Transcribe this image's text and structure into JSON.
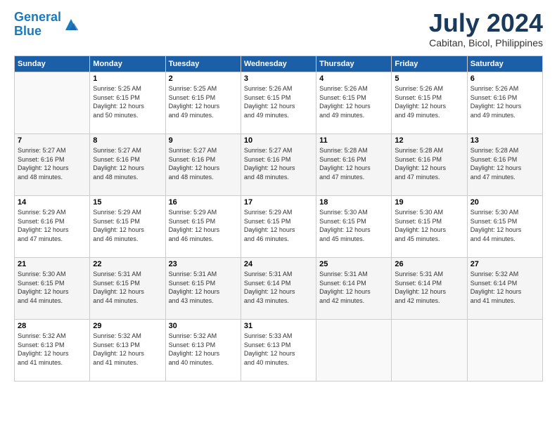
{
  "header": {
    "logo_line1": "General",
    "logo_line2": "Blue",
    "month_year": "July 2024",
    "location": "Cabitan, Bicol, Philippines"
  },
  "days_of_week": [
    "Sunday",
    "Monday",
    "Tuesday",
    "Wednesday",
    "Thursday",
    "Friday",
    "Saturday"
  ],
  "weeks": [
    [
      {
        "day": "",
        "content": ""
      },
      {
        "day": "1",
        "content": "Sunrise: 5:25 AM\nSunset: 6:15 PM\nDaylight: 12 hours\nand 50 minutes."
      },
      {
        "day": "2",
        "content": "Sunrise: 5:25 AM\nSunset: 6:15 PM\nDaylight: 12 hours\nand 49 minutes."
      },
      {
        "day": "3",
        "content": "Sunrise: 5:26 AM\nSunset: 6:15 PM\nDaylight: 12 hours\nand 49 minutes."
      },
      {
        "day": "4",
        "content": "Sunrise: 5:26 AM\nSunset: 6:15 PM\nDaylight: 12 hours\nand 49 minutes."
      },
      {
        "day": "5",
        "content": "Sunrise: 5:26 AM\nSunset: 6:15 PM\nDaylight: 12 hours\nand 49 minutes."
      },
      {
        "day": "6",
        "content": "Sunrise: 5:26 AM\nSunset: 6:16 PM\nDaylight: 12 hours\nand 49 minutes."
      }
    ],
    [
      {
        "day": "7",
        "content": "Sunrise: 5:27 AM\nSunset: 6:16 PM\nDaylight: 12 hours\nand 48 minutes."
      },
      {
        "day": "8",
        "content": "Sunrise: 5:27 AM\nSunset: 6:16 PM\nDaylight: 12 hours\nand 48 minutes."
      },
      {
        "day": "9",
        "content": "Sunrise: 5:27 AM\nSunset: 6:16 PM\nDaylight: 12 hours\nand 48 minutes."
      },
      {
        "day": "10",
        "content": "Sunrise: 5:27 AM\nSunset: 6:16 PM\nDaylight: 12 hours\nand 48 minutes."
      },
      {
        "day": "11",
        "content": "Sunrise: 5:28 AM\nSunset: 6:16 PM\nDaylight: 12 hours\nand 47 minutes."
      },
      {
        "day": "12",
        "content": "Sunrise: 5:28 AM\nSunset: 6:16 PM\nDaylight: 12 hours\nand 47 minutes."
      },
      {
        "day": "13",
        "content": "Sunrise: 5:28 AM\nSunset: 6:16 PM\nDaylight: 12 hours\nand 47 minutes."
      }
    ],
    [
      {
        "day": "14",
        "content": "Sunrise: 5:29 AM\nSunset: 6:16 PM\nDaylight: 12 hours\nand 47 minutes."
      },
      {
        "day": "15",
        "content": "Sunrise: 5:29 AM\nSunset: 6:15 PM\nDaylight: 12 hours\nand 46 minutes."
      },
      {
        "day": "16",
        "content": "Sunrise: 5:29 AM\nSunset: 6:15 PM\nDaylight: 12 hours\nand 46 minutes."
      },
      {
        "day": "17",
        "content": "Sunrise: 5:29 AM\nSunset: 6:15 PM\nDaylight: 12 hours\nand 46 minutes."
      },
      {
        "day": "18",
        "content": "Sunrise: 5:30 AM\nSunset: 6:15 PM\nDaylight: 12 hours\nand 45 minutes."
      },
      {
        "day": "19",
        "content": "Sunrise: 5:30 AM\nSunset: 6:15 PM\nDaylight: 12 hours\nand 45 minutes."
      },
      {
        "day": "20",
        "content": "Sunrise: 5:30 AM\nSunset: 6:15 PM\nDaylight: 12 hours\nand 44 minutes."
      }
    ],
    [
      {
        "day": "21",
        "content": "Sunrise: 5:30 AM\nSunset: 6:15 PM\nDaylight: 12 hours\nand 44 minutes."
      },
      {
        "day": "22",
        "content": "Sunrise: 5:31 AM\nSunset: 6:15 PM\nDaylight: 12 hours\nand 44 minutes."
      },
      {
        "day": "23",
        "content": "Sunrise: 5:31 AM\nSunset: 6:15 PM\nDaylight: 12 hours\nand 43 minutes."
      },
      {
        "day": "24",
        "content": "Sunrise: 5:31 AM\nSunset: 6:14 PM\nDaylight: 12 hours\nand 43 minutes."
      },
      {
        "day": "25",
        "content": "Sunrise: 5:31 AM\nSunset: 6:14 PM\nDaylight: 12 hours\nand 42 minutes."
      },
      {
        "day": "26",
        "content": "Sunrise: 5:31 AM\nSunset: 6:14 PM\nDaylight: 12 hours\nand 42 minutes."
      },
      {
        "day": "27",
        "content": "Sunrise: 5:32 AM\nSunset: 6:14 PM\nDaylight: 12 hours\nand 41 minutes."
      }
    ],
    [
      {
        "day": "28",
        "content": "Sunrise: 5:32 AM\nSunset: 6:13 PM\nDaylight: 12 hours\nand 41 minutes."
      },
      {
        "day": "29",
        "content": "Sunrise: 5:32 AM\nSunset: 6:13 PM\nDaylight: 12 hours\nand 41 minutes."
      },
      {
        "day": "30",
        "content": "Sunrise: 5:32 AM\nSunset: 6:13 PM\nDaylight: 12 hours\nand 40 minutes."
      },
      {
        "day": "31",
        "content": "Sunrise: 5:33 AM\nSunset: 6:13 PM\nDaylight: 12 hours\nand 40 minutes."
      },
      {
        "day": "",
        "content": ""
      },
      {
        "day": "",
        "content": ""
      },
      {
        "day": "",
        "content": ""
      }
    ]
  ]
}
